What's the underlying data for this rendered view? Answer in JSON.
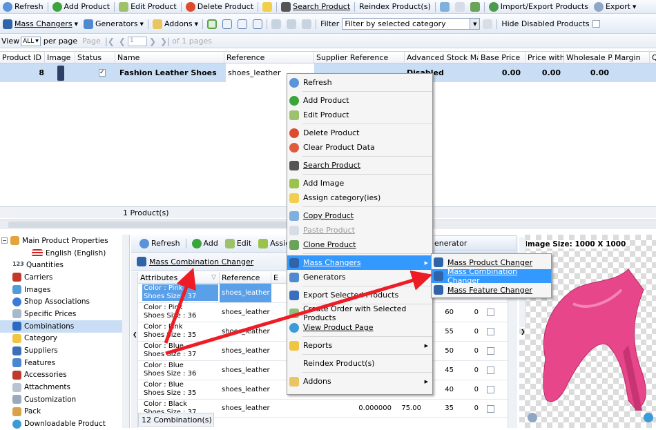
{
  "toolbar1": {
    "refresh": "Refresh",
    "add": "Add Product",
    "edit": "Edit Product",
    "delete": "Delete Product",
    "search": "Search Product",
    "reindex": "Reindex Product(s)",
    "import_export": "Import/Export Products",
    "export": "Export"
  },
  "toolbar2": {
    "mass_changers": "Mass Changers",
    "generators": "Generators",
    "addons": "Addons",
    "filter_label": "Filter",
    "filter_value": "Filter by selected category",
    "hide_disabled": "Hide Disabled Products"
  },
  "pager": {
    "view": "View",
    "view_value": "ALL",
    "per_page": "per page",
    "page": "Page",
    "page_value": "1",
    "of_pages": "of 1 pages"
  },
  "grid": {
    "headers": [
      "Product ID",
      "Image",
      "Status",
      "Name",
      "Reference",
      "Supplier Reference",
      "Advanced Stock Manage",
      "Base Price",
      "Price with Ta",
      "Wholesale P",
      "Margin",
      "Q"
    ],
    "row": {
      "id": "8",
      "name": "Fashion Leather Shoes",
      "reference": "shoes_leather",
      "asm": "Disabled",
      "base_price": "0.00",
      "price_tax": "0.00",
      "wholesale": "0.00"
    },
    "footer": "1 Product(s)"
  },
  "tree": {
    "items": [
      "Main Product Properties",
      "English (English)",
      "Quantities",
      "Carriers",
      "Images",
      "Shop Associations",
      "Specific Prices",
      "Combinations",
      "Category",
      "Suppliers",
      "Features",
      "Accessories",
      "Attachments",
      "Customization",
      "Pack",
      "Downloadable Product"
    ]
  },
  "combo": {
    "toolbar": {
      "refresh": "Refresh",
      "add": "Add",
      "edit": "Edit",
      "assign": "Assign Ima"
    },
    "mass_label": "Mass Combination Changer",
    "headers": [
      "Attributes",
      "Reference",
      "E"
    ],
    "rows": [
      {
        "attr1": "Color : Pink",
        "attr2": "Shoes Size : 37",
        "ref": "shoes_leather",
        "c1": "",
        "c2": "",
        "c3": "",
        "q": ""
      },
      {
        "attr1": "Color : Pink",
        "attr2": "Shoes Size : 36",
        "ref": "shoes_leather",
        "c1": "",
        "c2": "",
        "c3": "60",
        "q": "0"
      },
      {
        "attr1": "Color : Pink",
        "attr2": "Shoes Size : 35",
        "ref": "shoes_leather",
        "c1": "",
        "c2": "",
        "c3": "55",
        "q": "0"
      },
      {
        "attr1": "Color : Blue",
        "attr2": "Shoes Size : 37",
        "ref": "shoes_leather",
        "c1": "",
        "c2": "",
        "c3": "50",
        "q": "0"
      },
      {
        "attr1": "Color : Blue",
        "attr2": "Shoes Size : 36",
        "ref": "shoes_leather",
        "c1": "",
        "c2": "",
        "c3": "45",
        "q": "0"
      },
      {
        "attr1": "Color : Blue",
        "attr2": "Shoes Size : 35",
        "ref": "shoes_leather",
        "c1": "",
        "c2": "",
        "c3": "40",
        "q": "0"
      },
      {
        "attr1": "Color : Black",
        "attr2": "Shoes Size : 37",
        "ref": "shoes_leather",
        "c1": "0.000000",
        "c2": "75.00",
        "c3": "35",
        "q": "0"
      }
    ],
    "footer": "12 Combination(s)",
    "generator_tab": "enerator"
  },
  "image_panel": {
    "size_label": "Image Size: 1000 X 1000"
  },
  "context_menu": {
    "items": [
      "Refresh",
      "Add Product",
      "Edit Product",
      "Delete Product",
      "Clear Product Data",
      "Search Product",
      "Add Image",
      "Assign category(ies)",
      "Copy Product",
      "Paste Product",
      "Clone Product",
      "Mass Changers",
      "Generators",
      "Export Selected Products",
      "Create Order with Selected Products",
      "View Product Page",
      "Reports",
      "Reindex Product(s)",
      "Addons"
    ]
  },
  "submenu": {
    "items": [
      "Mass Product Changer",
      "Mass Combination Changer",
      "Mass Feature Changer"
    ]
  },
  "colors": {
    "accent": "#3399ff",
    "selection": "#c9def5",
    "arrow": "#ee1c25",
    "shoe": "#e8468a"
  }
}
